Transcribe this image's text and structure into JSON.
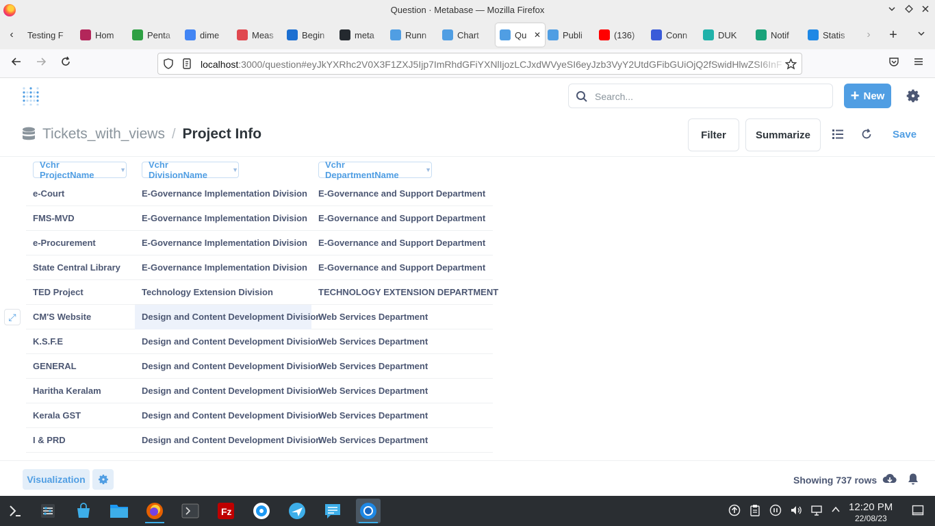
{
  "window": {
    "title": "Question · Metabase — Mozilla Firefox"
  },
  "tabs": [
    {
      "label": "Testing F",
      "color": "#00000000"
    },
    {
      "label": "Hom",
      "color": "#b3265a"
    },
    {
      "label": "Penta",
      "color": "#2ea043"
    },
    {
      "label": "dime",
      "color": "#4285f4"
    },
    {
      "label": "Meas",
      "color": "#e0484f"
    },
    {
      "label": "Begin",
      "color": "#1c6fd1"
    },
    {
      "label": "meta",
      "color": "#24292f"
    },
    {
      "label": "Runn",
      "color": "#509ee3"
    },
    {
      "label": "Chart",
      "color": "#509ee3"
    },
    {
      "label": "Qu",
      "color": "#509ee3"
    },
    {
      "label": "Publi",
      "color": "#509ee3"
    },
    {
      "label": "(136)",
      "color": "#ff0000"
    },
    {
      "label": "Conn",
      "color": "#3a5bd9"
    },
    {
      "label": "DUK",
      "color": "#20b2aa"
    },
    {
      "label": "Notif",
      "color": "#1aa37a"
    },
    {
      "label": "Statis",
      "color": "#1e88e5"
    }
  ],
  "url": {
    "host": "localhost",
    "rest": ":3000/question#eyJkYXRhc2V0X3F1ZXJ5Ijp7ImRhdGFiYXNlIjozLCJxdWVyeSI6eyJzb3VyY2UtdGFibGUiOjQ2fSwidHlwZSI6InF"
  },
  "app": {
    "search_placeholder": "Search...",
    "new_label": "New",
    "accent": "#509ee3"
  },
  "question": {
    "database": "Tickets_with_views",
    "title": "Project Info",
    "filter_label": "Filter",
    "summarize_label": "Summarize",
    "save_label": "Save"
  },
  "table": {
    "columns": [
      "Vchr ProjectName",
      "Vchr DivisionName",
      "Vchr DepartmentName"
    ],
    "rows": [
      [
        "e-Court",
        "E-Governance Implementation Division",
        "E-Governance and Support Department"
      ],
      [
        "FMS-MVD",
        "E-Governance Implementation Division",
        "E-Governance and Support Department"
      ],
      [
        "e-Procurement",
        "E-Governance Implementation Division",
        "E-Governance and Support Department"
      ],
      [
        "State Central Library",
        "E-Governance Implementation Division",
        "E-Governance and Support Department"
      ],
      [
        "TED Project",
        "Technology Extension Division",
        "TECHNOLOGY EXTENSION DEPARTMENT"
      ],
      [
        "CM'S Website",
        "Design and Content Development Division",
        "Web Services Department"
      ],
      [
        "K.S.F.E",
        "Design and Content Development Division",
        "Web Services Department"
      ],
      [
        "GENERAL",
        "Design and Content Development Division",
        "Web Services Department"
      ],
      [
        "Haritha Keralam",
        "Design and Content Development Division",
        "Web Services Department"
      ],
      [
        "Kerala GST",
        "Design and Content Development Division",
        "Web Services Department"
      ],
      [
        "I & PRD",
        "Design and Content Development Division",
        "Web Services Department"
      ]
    ]
  },
  "footer": {
    "visualization_label": "Visualization",
    "row_count": "Showing 737 rows"
  },
  "taskbar": {
    "time": "12:20 PM",
    "date": "22/08/23"
  }
}
